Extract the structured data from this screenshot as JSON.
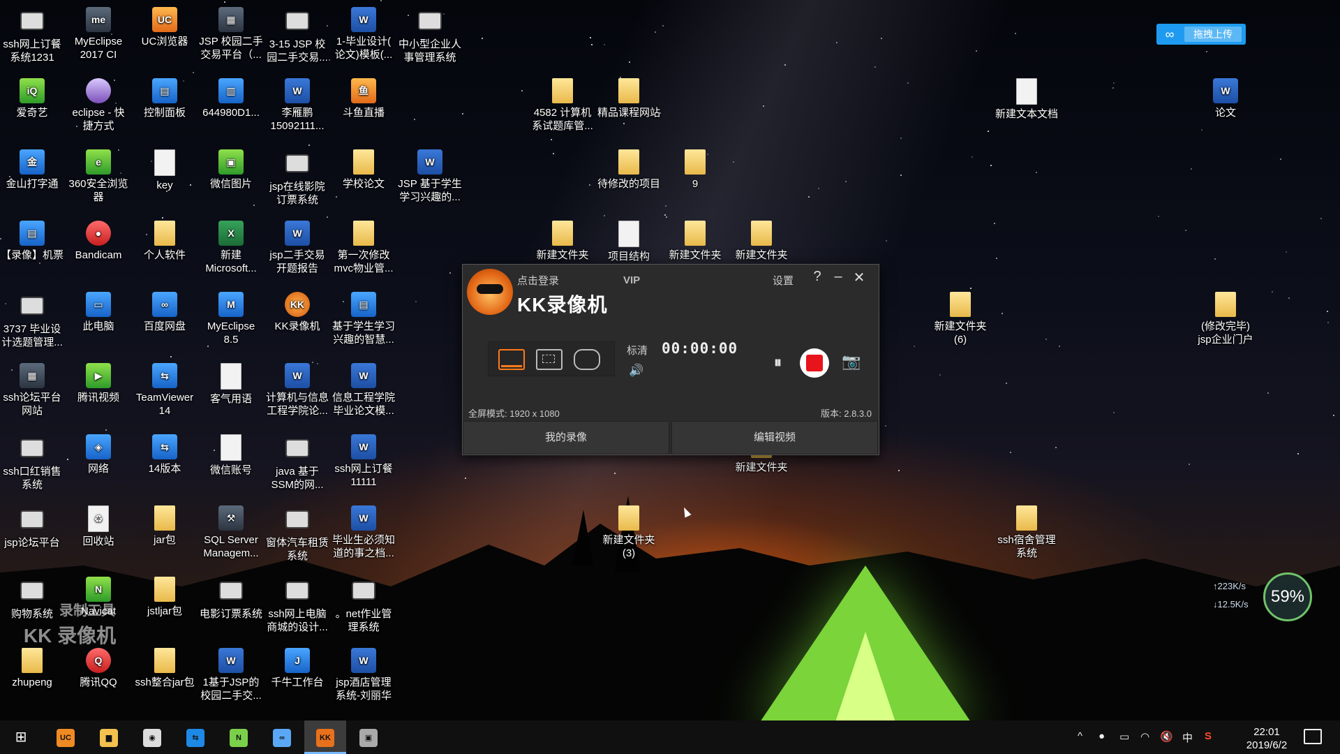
{
  "desktop_icons": [
    {
      "label": "ssh网上订餐\n系统1231",
      "kind": "media",
      "glyph": ""
    },
    {
      "label": "MyEclipse\n2017 CI",
      "kind": "app",
      "glyph": "me"
    },
    {
      "label": "UC浏览器",
      "kind": "orange",
      "glyph": "UC"
    },
    {
      "label": "JSP 校园二手\n交易平台（...",
      "kind": "app",
      "glyph": "▦"
    },
    {
      "label": "3-15 JSP 校\n园二手交易...",
      "kind": "media",
      "glyph": ""
    },
    {
      "label": "1-毕业设计(\n论文)模板(...",
      "kind": "word",
      "glyph": "W"
    },
    {
      "label": "中小型企业人\n事管理系统",
      "kind": "media",
      "glyph": ""
    },
    {
      "label": "爱奇艺",
      "kind": "green",
      "glyph": "iQ"
    },
    {
      "label": "eclipse - 快\n捷方式",
      "kind": "purple",
      "glyph": ""
    },
    {
      "label": "控制面板",
      "kind": "blue",
      "glyph": "▤"
    },
    {
      "label": "644980D1...",
      "kind": "blue",
      "glyph": "▥"
    },
    {
      "label": "李雁鹏\n15092111...",
      "kind": "word",
      "glyph": "W"
    },
    {
      "label": "斗鱼直播",
      "kind": "orange",
      "glyph": "鱼"
    },
    {
      "label": "金山打字通",
      "kind": "blue",
      "glyph": "金"
    },
    {
      "label": "360安全浏览\n器",
      "kind": "green",
      "glyph": "e"
    },
    {
      "label": "key",
      "kind": "doc",
      "glyph": ""
    },
    {
      "label": "微信图片",
      "kind": "green",
      "glyph": "▣"
    },
    {
      "label": "jsp在线影院\n订票系统",
      "kind": "media",
      "glyph": ""
    },
    {
      "label": "学校论文",
      "kind": "folder",
      "glyph": ""
    },
    {
      "label": "JSP 基于学生\n学习兴趣的...",
      "kind": "word",
      "glyph": "W"
    },
    {
      "label": "【录像】机票",
      "kind": "blue",
      "glyph": "▤"
    },
    {
      "label": "Bandicam",
      "kind": "red",
      "glyph": "●"
    },
    {
      "label": "个人软件",
      "kind": "folder",
      "glyph": ""
    },
    {
      "label": "新建\nMicrosoft...",
      "kind": "excel",
      "glyph": "X"
    },
    {
      "label": "jsp二手交易\n开题报告",
      "kind": "word",
      "glyph": "W"
    },
    {
      "label": "第一次修改\nmvc物业管...",
      "kind": "folder",
      "glyph": ""
    },
    {
      "label": "3737 毕业设\n计选题管理...",
      "kind": "media",
      "glyph": ""
    },
    {
      "label": "此电脑",
      "kind": "blue",
      "glyph": "▭"
    },
    {
      "label": "百度网盘",
      "kind": "blue",
      "glyph": "∞"
    },
    {
      "label": "MyEclipse\n8.5",
      "kind": "blue",
      "glyph": "M"
    },
    {
      "label": "KK录像机",
      "kind": "kk",
      "glyph": "KK"
    },
    {
      "label": "基于学生学习\n兴趣的智慧...",
      "kind": "blue",
      "glyph": "▤"
    },
    {
      "label": "ssh论坛平台\n网站",
      "kind": "app",
      "glyph": "▦"
    },
    {
      "label": "腾讯视频",
      "kind": "green",
      "glyph": "▶"
    },
    {
      "label": "TeamViewer\n14",
      "kind": "blue",
      "glyph": "⇆"
    },
    {
      "label": "客气用语",
      "kind": "doc",
      "glyph": ""
    },
    {
      "label": "计算机与信息\n工程学院论...",
      "kind": "word",
      "glyph": "W"
    },
    {
      "label": "信息工程学院\n毕业论文模...",
      "kind": "word",
      "glyph": "W"
    },
    {
      "label": "ssh口红销售\n系统",
      "kind": "media",
      "glyph": ""
    },
    {
      "label": "网络",
      "kind": "blue",
      "glyph": "◈"
    },
    {
      "label": "14版本",
      "kind": "blue",
      "glyph": "⇆"
    },
    {
      "label": "微信账号",
      "kind": "doc",
      "glyph": ""
    },
    {
      "label": "java 基于\nSSM的网...",
      "kind": "media",
      "glyph": ""
    },
    {
      "label": "ssh网上订餐\n11111",
      "kind": "word",
      "glyph": "W"
    },
    {
      "label": "jsp论坛平台",
      "kind": "media",
      "glyph": ""
    },
    {
      "label": "回收站",
      "kind": "doc",
      "glyph": "♻"
    },
    {
      "label": "jar包",
      "kind": "folder",
      "glyph": ""
    },
    {
      "label": "SQL Server\nManagem...",
      "kind": "app",
      "glyph": "⚒"
    },
    {
      "label": "窗体汽车租赁\n系统",
      "kind": "media",
      "glyph": ""
    },
    {
      "label": "毕业生必须知\n道的事之档...",
      "kind": "word",
      "glyph": "W"
    },
    {
      "label": "购物系统",
      "kind": "media",
      "glyph": ""
    },
    {
      "label": "Navicat",
      "kind": "green",
      "glyph": "N"
    },
    {
      "label": "jstljar包",
      "kind": "folder",
      "glyph": ""
    },
    {
      "label": "电影订票系统",
      "kind": "media",
      "glyph": ""
    },
    {
      "label": "ssh网上电脑\n商城的设计...",
      "kind": "media",
      "glyph": ""
    },
    {
      "label": "。net作业管\n理系统",
      "kind": "media",
      "glyph": ""
    },
    {
      "label": "zhupeng",
      "kind": "folder",
      "glyph": ""
    },
    {
      "label": "腾讯QQ",
      "kind": "red",
      "glyph": "Q"
    },
    {
      "label": "ssh整合jar包",
      "kind": "folder",
      "glyph": ""
    },
    {
      "label": "1基于JSP的\n校园二手交...",
      "kind": "word",
      "glyph": "W"
    },
    {
      "label": "千牛工作台",
      "kind": "blue",
      "glyph": "J"
    },
    {
      "label": "jsp酒店管理\n系统-刘丽华",
      "kind": "word",
      "glyph": "W"
    },
    {
      "label": "4582 计算机\n系试题库管...",
      "kind": "folder",
      "glyph": ""
    },
    {
      "label": "精品课程网站",
      "kind": "folder",
      "glyph": ""
    },
    {
      "label": "新建文本文档",
      "kind": "doc",
      "glyph": ""
    },
    {
      "label": "论文",
      "kind": "word",
      "glyph": "W"
    },
    {
      "label": "待修改的项目",
      "kind": "folder",
      "glyph": ""
    },
    {
      "label": "9",
      "kind": "folder",
      "glyph": ""
    },
    {
      "label": "新建文件夹",
      "kind": "folder",
      "glyph": ""
    },
    {
      "label": "项目结构",
      "kind": "doc",
      "glyph": ""
    },
    {
      "label": "新建文件夹",
      "kind": "folder",
      "glyph": ""
    },
    {
      "label": "新建文件夹",
      "kind": "folder",
      "glyph": ""
    },
    {
      "label": "新建文件夹\n(6)",
      "kind": "folder",
      "glyph": ""
    },
    {
      "label": "(修改完毕)\njsp企业门户",
      "kind": "folder",
      "glyph": ""
    },
    {
      "label": "新建文件夹",
      "kind": "folder",
      "glyph": ""
    },
    {
      "label": "新建文件夹\n(3)",
      "kind": "folder",
      "glyph": ""
    },
    {
      "label": "ssh宿舍管理\n系统",
      "kind": "folder",
      "glyph": ""
    }
  ],
  "kk_window": {
    "login": "点击登录",
    "vip": "VIP",
    "title": "KK录像机",
    "settings": "设置",
    "help": "?",
    "minimize": "–",
    "close": "✕",
    "quality": "标清",
    "volume_icon": "🔊",
    "timer": "00:00:00",
    "pause_icon": "⏸",
    "camera_icon": "📷",
    "mode_info": "全屏模式: 1920 x 1080",
    "version": "版本: 2.8.3.0",
    "tab_recordings": "我的录像",
    "tab_edit": "编辑视频"
  },
  "upload_button": {
    "icon": "∞",
    "label": "拖拽上传"
  },
  "speed_widget": {
    "up": "↑223K/s",
    "down": "↓12.5K/s",
    "percent": "59%"
  },
  "watermark": {
    "line1": "录制工具",
    "line2": "KK 录像机"
  },
  "taskbar": {
    "start_icon": "⊞",
    "apps": [
      {
        "name": "uc",
        "glyph": "UC"
      },
      {
        "name": "explorer",
        "glyph": "▆"
      },
      {
        "name": "github",
        "glyph": "◉"
      },
      {
        "name": "teamviewer",
        "glyph": "⇆"
      },
      {
        "name": "navicat",
        "glyph": "N"
      },
      {
        "name": "baidu",
        "glyph": "∞"
      },
      {
        "name": "kk",
        "glyph": "KK"
      },
      {
        "name": "media",
        "glyph": "▣"
      }
    ],
    "tray": {
      "chevron": "^",
      "ime": "中",
      "s_icon": "S"
    },
    "time": "22:01",
    "date": "2019/6/2"
  }
}
